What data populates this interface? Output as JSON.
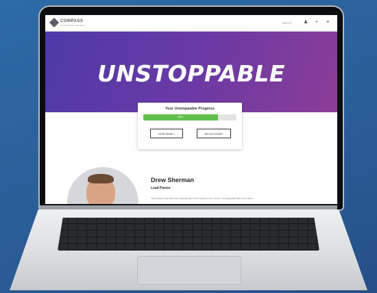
{
  "site": {
    "logo_text": "COMPASS",
    "logo_sub": "CHRISTIAN CHURCH",
    "nav_link": "ABOUT",
    "icons": [
      "person-icon",
      "plus-icon",
      "menu-icon"
    ]
  },
  "hero": {
    "title": "UNSTOPPABLE"
  },
  "progress_card": {
    "title": "Your Unstoppable Progress",
    "progress_percent": 80,
    "bar_label": "80%",
    "buttons": [
      "GIVE NOW >",
      "MY ACCOUNT"
    ]
  },
  "profile": {
    "name": "Drew Sherman",
    "role": "Lead Pastor",
    "bio": "This season has been the most pivotal in the history of our church. Unstoppable asks us to dare..."
  },
  "colors": {
    "hero_start": "#4d3aa8",
    "hero_end": "#8b3d96",
    "progress": "#5fbf4c"
  }
}
